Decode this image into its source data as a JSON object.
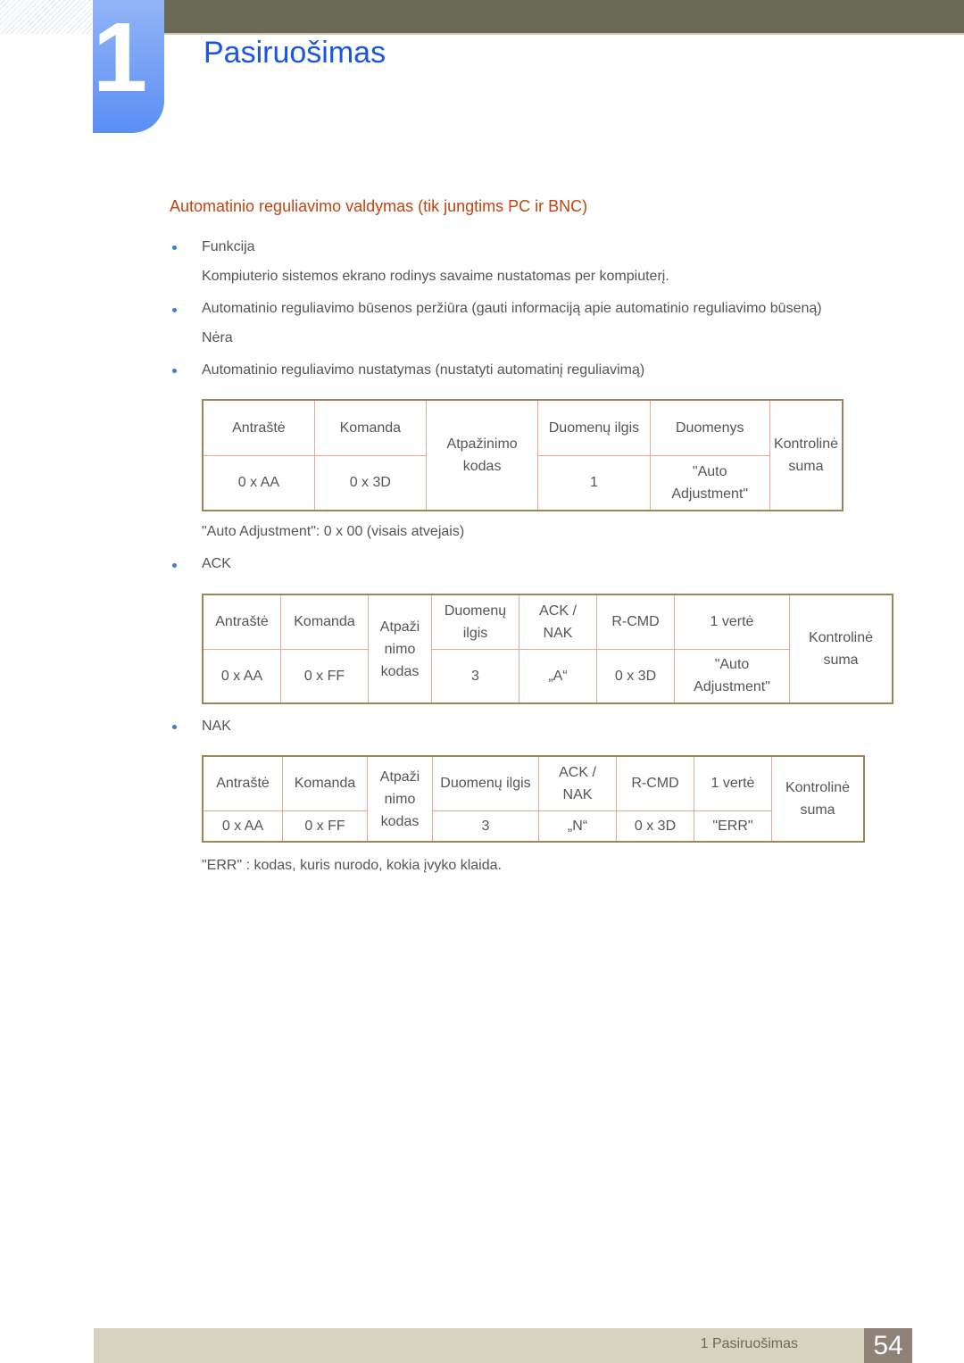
{
  "header": {
    "chapter_number": "1",
    "chapter_title": "Pasiruošimas"
  },
  "section": {
    "title": "Automatinio reguliavimo valdymas (tik jungtims PC ir BNC)"
  },
  "items": [
    {
      "label": "Funkcija",
      "detail": "Kompiuterio sistemos ekrano rodinys savaime nustatomas per kompiuterį."
    },
    {
      "label": "Automatinio reguliavimo būsenos peržiūra (gauti informaciją apie automatinio reguliavimo būseną)",
      "detail": "Nėra"
    },
    {
      "label": "Automatinio reguliavimo nustatymas (nustatyti automatinį reguliavimą)"
    }
  ],
  "table1": {
    "headers": [
      "Antraštė",
      "Komanda",
      "Atpažinimo kodas",
      "Duomenų ilgis",
      "Duomenys",
      "Kontrolinė suma"
    ],
    "values": [
      "0 x AA",
      "0 x 3D",
      "1",
      "\"Auto Adjustment\""
    ],
    "note": "\"Auto Adjustment\": 0 x 00 (visais atvejais)"
  },
  "ack": {
    "label": "ACK",
    "headers": [
      "Antraštė",
      "Komanda",
      "Atpaži nimo kodas",
      "Duomenų ilgis",
      "ACK / NAK",
      "R-CMD",
      "1 vertė",
      "Kontrolinė suma"
    ],
    "values": [
      "0 x AA",
      "0 x FF",
      "3",
      "„A“",
      "0 x 3D",
      "\"Auto Adjustment\""
    ]
  },
  "nak": {
    "label": "NAK",
    "headers": [
      "Antraštė",
      "Komanda",
      "Atpaži nimo kodas",
      "Duomenų ilgis",
      "ACK / NAK",
      "R-CMD",
      "1 vertė",
      "Kontrolinė suma"
    ],
    "values": [
      "0 x AA",
      "0 x FF",
      "3",
      "„N“",
      "0 x 3D",
      "\"ERR\""
    ],
    "note": "\"ERR\" : kodas, kuris nurodo, kokia įvyko klaida."
  },
  "footer": {
    "label": "1 Pasiruošimas",
    "page": "54"
  }
}
